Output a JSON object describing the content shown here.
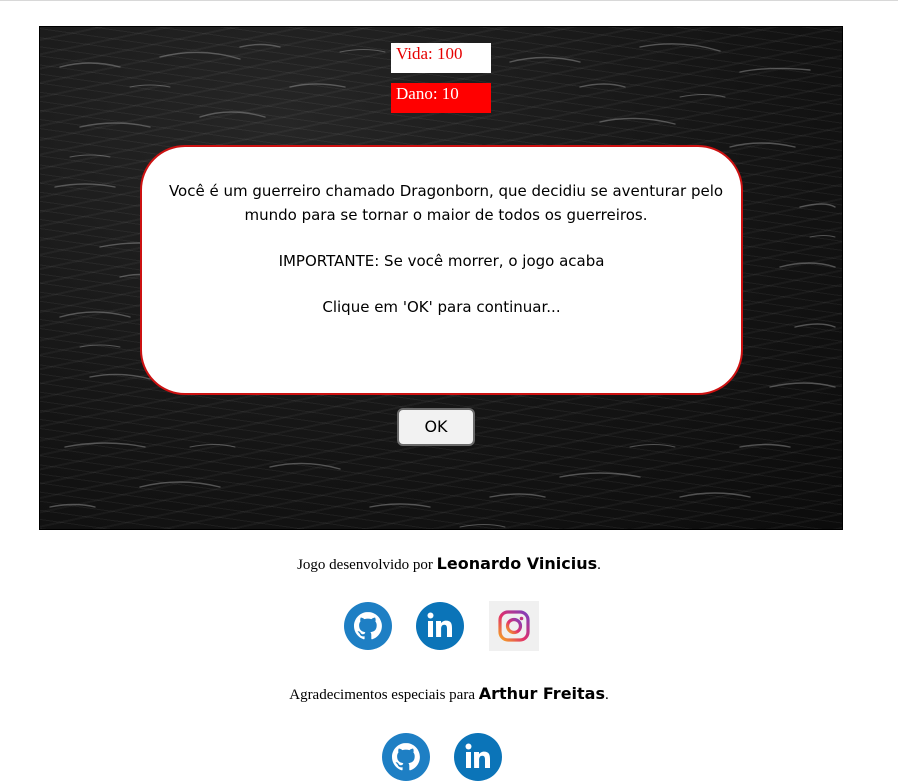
{
  "hud": {
    "life_label": "Vida: 100",
    "damage_label": "Dano: 10"
  },
  "dialog": {
    "intro": "Você é um guerreiro chamado Dragonborn, que decidiu se aventurar pelo mundo para se tornar o maior de todos os guerreiros.",
    "warning": "IMPORTANTE: Se você morrer, o jogo acaba",
    "instruction": "Clique em 'OK' para continuar..."
  },
  "ok_button": {
    "label": "OK"
  },
  "footer": {
    "dev_prefix": "Jogo desenvolvido por ",
    "dev_name": "Leonardo Vinicius",
    "dev_suffix": ".",
    "thanks_prefix": "Agradecimentos especiais para ",
    "thanks_name": "Arthur Freitas",
    "thanks_suffix": "."
  },
  "icons": {
    "github": "github-icon",
    "linkedin": "linkedin-icon",
    "instagram": "instagram-icon"
  },
  "colors": {
    "life_text": "#e60000",
    "damage_bg": "#ff0000",
    "dialog_border": "#cc1111",
    "github_bg": "#1e7fc4",
    "linkedin_bg": "#0b74b8"
  }
}
